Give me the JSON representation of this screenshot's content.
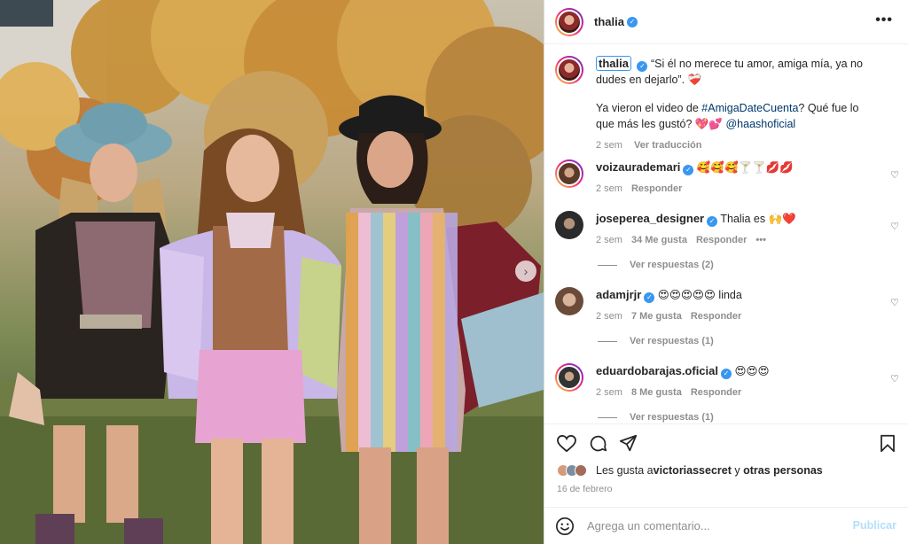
{
  "post": {
    "username": "thalia",
    "caption_quote": "“Si él no merece tu amor, amiga mía, ya no dudes en dejarlo”. ❤️‍🩹",
    "caption_line2_pre": "Ya vieron el video de ",
    "caption_hashtag": "#AmigaDateCuenta",
    "caption_line2_post": "? Qué fue lo que más les gustó? 💖💕 ",
    "caption_mention": "@haashoficial",
    "caption_time": "2 sem",
    "caption_translate": "Ver traducción"
  },
  "comments": [
    {
      "user": "voizaurademari",
      "text": "🥰🥰🥰🍸🍸💋💋",
      "time": "2 sem",
      "likes": "",
      "reply": "Responder",
      "replies": ""
    },
    {
      "user": "joseperea_designer",
      "text": "Thalia es 🙌❤️",
      "time": "2 sem",
      "likes": "34 Me gusta",
      "reply": "Responder",
      "replies": "Ver respuestas (2)"
    },
    {
      "user": "adamjrjr",
      "text": "😍😍😍😍😍 linda",
      "time": "2 sem",
      "likes": "7 Me gusta",
      "reply": "Responder",
      "replies": "Ver respuestas (1)"
    },
    {
      "user": "eduardobarajas.oficial",
      "text": "😍😍😍",
      "time": "2 sem",
      "likes": "8 Me gusta",
      "reply": "Responder",
      "replies": "Ver respuestas (1)"
    }
  ],
  "likes": {
    "prefix": "Les gusta a ",
    "user": "victoriassecret",
    "connector": " y ",
    "others": "otras personas"
  },
  "date": "16 de febrero",
  "add_comment": {
    "placeholder": "Agrega un comentario...",
    "publish": "Publicar"
  },
  "icons": {
    "more": "more-options-icon",
    "like": "heart-icon",
    "comment": "comment-icon",
    "share": "paper-plane-icon",
    "save": "bookmark-icon",
    "emoji": "emoji-icon",
    "next": "chevron-right-icon"
  },
  "colors": {
    "verified": "#3897f0",
    "link": "#00376b",
    "muted": "#8e8e8e",
    "publish_disabled": "#b2dffc"
  }
}
